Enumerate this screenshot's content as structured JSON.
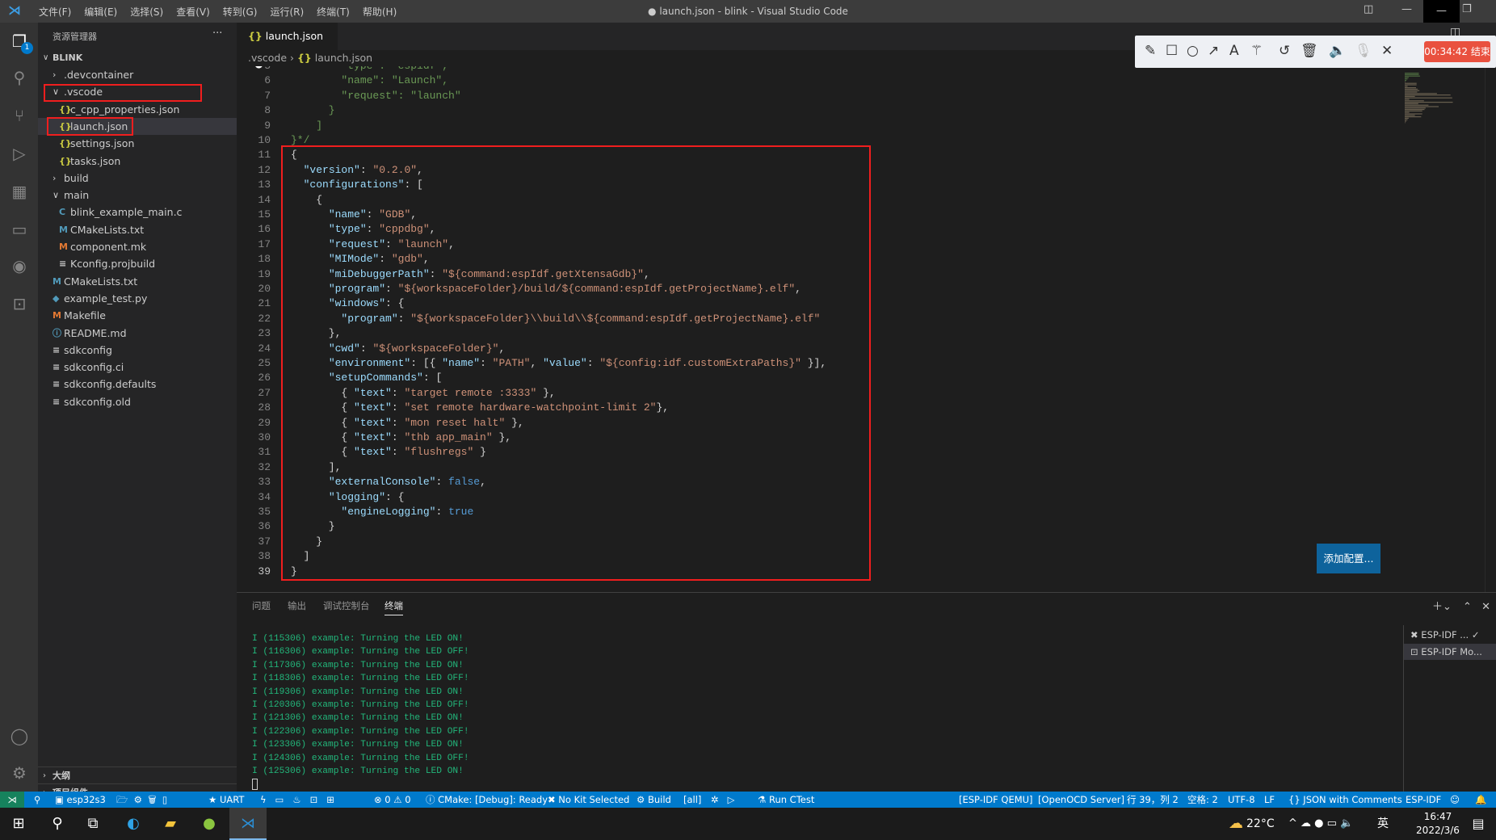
{
  "window": {
    "title": "● launch.json - blink - Visual Studio Code",
    "menu": [
      "文件(F)",
      "编辑(E)",
      "选择(S)",
      "查看(V)",
      "转到(G)",
      "运行(R)",
      "终端(T)",
      "帮助(H)"
    ]
  },
  "activity": {
    "badge": "1",
    "icons": [
      "files-icon",
      "search-icon",
      "source-control-icon",
      "run-debug-icon",
      "extensions-icon",
      "remote-explorer-icon",
      "esp-idf-icon",
      "test-icon"
    ],
    "bottom": [
      "account-icon",
      "gear-icon"
    ]
  },
  "sidebar": {
    "title": "资源管理器",
    "more": "···",
    "root": "BLINK",
    "items": [
      {
        "label": ".devcontainer",
        "type": "folder-closed"
      },
      {
        "label": ".vscode",
        "type": "folder-open"
      },
      {
        "label": "c_cpp_properties.json",
        "type": "json"
      },
      {
        "label": "launch.json",
        "type": "json",
        "selected": true
      },
      {
        "label": "settings.json",
        "type": "json"
      },
      {
        "label": "tasks.json",
        "type": "json"
      },
      {
        "label": "build",
        "type": "folder-closed"
      },
      {
        "label": "main",
        "type": "folder-open"
      },
      {
        "label": "blink_example_main.c",
        "type": "c"
      },
      {
        "label": "CMakeLists.txt",
        "type": "cmake"
      },
      {
        "label": "component.mk",
        "type": "make"
      },
      {
        "label": "Kconfig.projbuild",
        "type": "text"
      },
      {
        "label": "CMakeLists.txt",
        "type": "cmake"
      },
      {
        "label": "example_test.py",
        "type": "python"
      },
      {
        "label": "Makefile",
        "type": "make"
      },
      {
        "label": "README.md",
        "type": "info"
      },
      {
        "label": "sdkconfig",
        "type": "text"
      },
      {
        "label": "sdkconfig.ci",
        "type": "text"
      },
      {
        "label": "sdkconfig.defaults",
        "type": "text"
      },
      {
        "label": "sdkconfig.old",
        "type": "text"
      }
    ],
    "outline": "大纲",
    "components": "项目组件"
  },
  "editor": {
    "tab": "launch.json",
    "tab_dirty": "●",
    "breadcrumb": [
      ".vscode",
      "launch.json"
    ],
    "first_line": 5,
    "lines": [
      [
        [
          "c",
          "        \"type\": \"espidf\","
        ]
      ],
      [
        [
          "c",
          "        \"name\": \"Launch\","
        ]
      ],
      [
        [
          "c",
          "        \"request\": \"launch\""
        ]
      ],
      [
        [
          "c",
          "      }"
        ]
      ],
      [
        [
          "c",
          "    ]"
        ]
      ],
      [
        [
          "c",
          "}*/"
        ]
      ],
      [
        [
          "p",
          "{"
        ]
      ],
      [
        [
          "p",
          "  "
        ],
        [
          "k",
          "\"version\""
        ],
        [
          "p",
          ": "
        ],
        [
          "s",
          "\"0.2.0\""
        ],
        [
          "p",
          ","
        ]
      ],
      [
        [
          "p",
          "  "
        ],
        [
          "k",
          "\"configurations\""
        ],
        [
          "p",
          ": ["
        ]
      ],
      [
        [
          "p",
          "    {"
        ]
      ],
      [
        [
          "p",
          "      "
        ],
        [
          "k",
          "\"name\""
        ],
        [
          "p",
          ": "
        ],
        [
          "s",
          "\"GDB\""
        ],
        [
          "p",
          ","
        ]
      ],
      [
        [
          "p",
          "      "
        ],
        [
          "k",
          "\"type\""
        ],
        [
          "p",
          ": "
        ],
        [
          "s",
          "\"cppdbg\""
        ],
        [
          "p",
          ","
        ]
      ],
      [
        [
          "p",
          "      "
        ],
        [
          "k",
          "\"request\""
        ],
        [
          "p",
          ": "
        ],
        [
          "s",
          "\"launch\""
        ],
        [
          "p",
          ","
        ]
      ],
      [
        [
          "p",
          "      "
        ],
        [
          "k",
          "\"MIMode\""
        ],
        [
          "p",
          ": "
        ],
        [
          "s",
          "\"gdb\""
        ],
        [
          "p",
          ","
        ]
      ],
      [
        [
          "p",
          "      "
        ],
        [
          "k",
          "\"miDebuggerPath\""
        ],
        [
          "p",
          ": "
        ],
        [
          "s",
          "\"${command:espIdf.getXtensaGdb}\""
        ],
        [
          "p",
          ","
        ]
      ],
      [
        [
          "p",
          "      "
        ],
        [
          "k",
          "\"program\""
        ],
        [
          "p",
          ": "
        ],
        [
          "s",
          "\"${workspaceFolder}/build/${command:espIdf.getProjectName}.elf\""
        ],
        [
          "p",
          ","
        ]
      ],
      [
        [
          "p",
          "      "
        ],
        [
          "k",
          "\"windows\""
        ],
        [
          "p",
          ": {"
        ]
      ],
      [
        [
          "p",
          "        "
        ],
        [
          "k",
          "\"program\""
        ],
        [
          "p",
          ": "
        ],
        [
          "s",
          "\"${workspaceFolder}\\\\build\\\\${command:espIdf.getProjectName}.elf\""
        ]
      ],
      [
        [
          "p",
          "      },"
        ]
      ],
      [
        [
          "p",
          "      "
        ],
        [
          "k",
          "\"cwd\""
        ],
        [
          "p",
          ": "
        ],
        [
          "s",
          "\"${workspaceFolder}\""
        ],
        [
          "p",
          ","
        ]
      ],
      [
        [
          "p",
          "      "
        ],
        [
          "k",
          "\"environment\""
        ],
        [
          "p",
          ": [{ "
        ],
        [
          "k",
          "\"name\""
        ],
        [
          "p",
          ": "
        ],
        [
          "s",
          "\"PATH\""
        ],
        [
          "p",
          ", "
        ],
        [
          "k",
          "\"value\""
        ],
        [
          "p",
          ": "
        ],
        [
          "s",
          "\"${config:idf.customExtraPaths}\""
        ],
        [
          "p",
          " }],"
        ]
      ],
      [
        [
          "p",
          "      "
        ],
        [
          "k",
          "\"setupCommands\""
        ],
        [
          "p",
          ": ["
        ]
      ],
      [
        [
          "p",
          "        { "
        ],
        [
          "k",
          "\"text\""
        ],
        [
          "p",
          ": "
        ],
        [
          "s",
          "\"target remote :3333\""
        ],
        [
          "p",
          " },"
        ]
      ],
      [
        [
          "p",
          "        { "
        ],
        [
          "k",
          "\"text\""
        ],
        [
          "p",
          ": "
        ],
        [
          "s",
          "\"set remote hardware-watchpoint-limit 2\""
        ],
        [
          "p",
          "},"
        ]
      ],
      [
        [
          "p",
          "        { "
        ],
        [
          "k",
          "\"text\""
        ],
        [
          "p",
          ": "
        ],
        [
          "s",
          "\"mon reset halt\""
        ],
        [
          "p",
          " },"
        ]
      ],
      [
        [
          "p",
          "        { "
        ],
        [
          "k",
          "\"text\""
        ],
        [
          "p",
          ": "
        ],
        [
          "s",
          "\"thb app_main\""
        ],
        [
          "p",
          " },"
        ]
      ],
      [
        [
          "p",
          "        { "
        ],
        [
          "k",
          "\"text\""
        ],
        [
          "p",
          ": "
        ],
        [
          "s",
          "\"flushregs\""
        ],
        [
          "p",
          " }"
        ]
      ],
      [
        [
          "p",
          "      ],"
        ]
      ],
      [
        [
          "p",
          "      "
        ],
        [
          "k",
          "\"externalConsole\""
        ],
        [
          "p",
          ": "
        ],
        [
          "b",
          "false"
        ],
        [
          "p",
          ","
        ]
      ],
      [
        [
          "p",
          "      "
        ],
        [
          "k",
          "\"logging\""
        ],
        [
          "p",
          ": {"
        ]
      ],
      [
        [
          "p",
          "        "
        ],
        [
          "k",
          "\"engineLogging\""
        ],
        [
          "p",
          ": "
        ],
        [
          "b",
          "true"
        ]
      ],
      [
        [
          "p",
          "      }"
        ]
      ],
      [
        [
          "p",
          "    }"
        ]
      ],
      [
        [
          "p",
          "  ]"
        ]
      ],
      [
        [
          "p",
          "}"
        ]
      ]
    ],
    "current_line": 39,
    "add_config_button": "添加配置..."
  },
  "annotation_toolbar": {
    "tools": [
      "pencil-icon",
      "rectangle-icon",
      "circle-icon",
      "arrow-icon",
      "text-icon",
      "magic-wand-icon",
      "undo-icon",
      "trash-icon",
      "speaker-icon",
      "mic-muted-icon",
      "close-icon"
    ],
    "timer": "00:34:42 结束"
  },
  "panel": {
    "tabs": [
      "问题",
      "输出",
      "调试控制台",
      "终端"
    ],
    "active_tab": "终端",
    "terminal_lines": [
      "I (115306) example: Turning the LED ON!",
      "I (116306) example: Turning the LED OFF!",
      "I (117306) example: Turning the LED ON!",
      "I (118306) example: Turning the LED OFF!",
      "I (119306) example: Turning the LED ON!",
      "I (120306) example: Turning the LED OFF!",
      "I (121306) example: Turning the LED ON!",
      "I (122306) example: Turning the LED OFF!",
      "I (123306) example: Turning the LED ON!",
      "I (124306) example: Turning the LED OFF!",
      "I (125306) example: Turning the LED ON!"
    ],
    "terminals": [
      "ESP-IDF ...",
      "ESP-IDF Mo..."
    ]
  },
  "statusbar": {
    "left": [
      "esp32s3",
      "UART",
      "⊗ 0 ⚠ 0",
      "CMake: [Debug]: Ready",
      "No Kit Selected",
      "Build",
      "[all]",
      "Run CTest"
    ],
    "right": [
      "[ESP-IDF QEMU]",
      "[OpenOCD Server]",
      "行 39，列 2",
      "空格: 2",
      "UTF-8",
      "LF",
      "JSON with Comments",
      "ESP-IDF"
    ]
  },
  "taskbar": {
    "weather": "22°C",
    "ime": "英",
    "time": "16:47",
    "date": "2022/3/6"
  },
  "colors": {
    "accent": "#007acc",
    "annotation_red": "#f01e1e",
    "terminal_green": "#23d18b",
    "timer": "#e9513f"
  }
}
